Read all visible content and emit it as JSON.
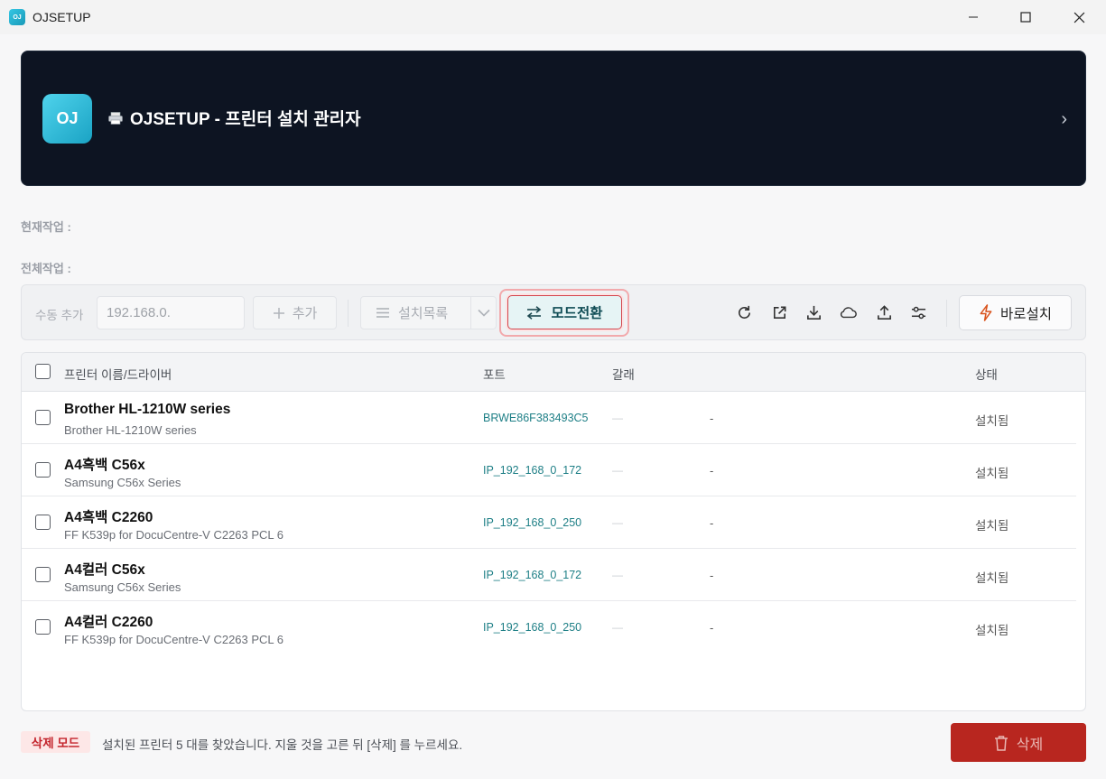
{
  "window": {
    "title": "OJSETUP",
    "app_icon_text": "OJ"
  },
  "banner": {
    "logo_text": "OJ",
    "title": "OJSETUP - 프린터 설치 관리자",
    "chevron": "›"
  },
  "tasks": {
    "current_label": "현재작업 :",
    "total_label": "전체작업 :"
  },
  "toolbar": {
    "manual_add_label": "수동 추가",
    "ip_input_value": "192.168.0.",
    "add_label": "추가",
    "install_list_label": "설치목록",
    "mode_switch_label": "모드전환",
    "quick_install_label": "바로설치",
    "icons": [
      "refresh-icon",
      "external-link-icon",
      "download-icon",
      "cloud-icon",
      "upload-icon",
      "sliders-icon"
    ]
  },
  "table": {
    "headers": {
      "name": "프린터 이름/드라이버",
      "port": "포트",
      "type": "갈래",
      "status": "상태"
    },
    "rows": [
      {
        "name": "Brother HL-1210W series",
        "driver": "Brother HL-1210W series",
        "port": "BRWE86F383493C5",
        "dash1": "—",
        "dash2": "-",
        "status": "설치됨"
      },
      {
        "name": "A4흑백 C56x",
        "driver": "Samsung C56x Series",
        "port": "IP_192_168_0_172",
        "dash1": "—",
        "dash2": "-",
        "status": "설치됨"
      },
      {
        "name": "A4흑백 C2260",
        "driver": "FF K539p for DocuCentre-V C2263 PCL 6",
        "port": "IP_192_168_0_250",
        "dash1": "—",
        "dash2": "-",
        "status": "설치됨"
      },
      {
        "name": "A4컬러 C56x",
        "driver": "Samsung C56x Series",
        "port": "IP_192_168_0_172",
        "dash1": "—",
        "dash2": "-",
        "status": "설치됨"
      },
      {
        "name": "A4컬러 C2260",
        "driver": "FF K539p for DocuCentre-V C2263 PCL 6",
        "port": "IP_192_168_0_250",
        "dash1": "—",
        "dash2": "-",
        "status": "설치됨"
      }
    ]
  },
  "footer": {
    "mode_badge": "삭제 모드",
    "message": "설치된 프린터 5 대를 찾았습니다. 지울 것을 고른 뒤 [삭제] 를 누르세요.",
    "delete_label": "삭제"
  },
  "colors": {
    "banner_bg": "#0d1422",
    "accent_teal": "#1e7f86",
    "danger": "#b8261f",
    "mode_highlight": "#d2454c"
  }
}
